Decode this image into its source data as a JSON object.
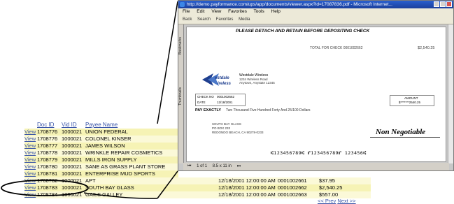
{
  "list": {
    "headers": {
      "doc_id": "Doc ID",
      "vid": "Vid ID",
      "payee": "Payee Name"
    },
    "view_label": "View",
    "rows": [
      {
        "doc": "1708776",
        "vid": "1000021",
        "payee": "UNION FEDERAL"
      },
      {
        "doc": "1708776",
        "vid": "1000021",
        "payee": "COLONEL KINSER"
      },
      {
        "doc": "1708777",
        "vid": "1000021",
        "payee": "JAMES WILSON"
      },
      {
        "doc": "1708778",
        "vid": "1000021",
        "payee": "WRINKLE REPAIR COSMETICS"
      },
      {
        "doc": "1708779",
        "vid": "1000021",
        "payee": "MILLS IRON SUPPLY"
      },
      {
        "doc": "1708780",
        "vid": "1000021",
        "payee": "SANE AS GRASS PLANT STORE"
      },
      {
        "doc": "1708781",
        "vid": "1000021",
        "payee": "ENTERPRISE MUD SPORTS"
      }
    ],
    "wide_rows": [
      {
        "doc": "1708782",
        "vid": "1000021",
        "payee": "APT",
        "date": "12/18/2001 12:00:00 AM",
        "num": "0001002661",
        "amount": "$37.95"
      },
      {
        "doc": "1708783",
        "vid": "1000021",
        "payee": "SOUTH BAY GLASS",
        "date": "12/18/2001 12:00:00 AM",
        "num": "0001002662",
        "amount": "$2,540.25"
      },
      {
        "doc": "1708784",
        "vid": "1000021",
        "payee": "GAILS GALLEY",
        "date": "12/18/2001 12:00:00 AM",
        "num": "0001002663",
        "amount": "$557.00"
      }
    ],
    "pager": {
      "prev": "<< Prev",
      "next": "Next >>"
    }
  },
  "viewer": {
    "title": "http://demo.payformance.com/ups/app/documents/viewer.aspx?id=17087836.pdf - Microsoft Internet...",
    "menu": [
      "File",
      "Edit",
      "View",
      "Favorites",
      "Tools",
      "Help"
    ],
    "toolbar": [
      "Back",
      "Search",
      "Favorites",
      "Media"
    ],
    "side_tabs": [
      "Bookmarks",
      "Thumbnails"
    ],
    "status": {
      "page": "1 of 1",
      "size": "8.5 x 11 in"
    },
    "check": {
      "detach_text": "PLEASE DETACH AND RETAIN BEFORE DEPOSITING CHECK",
      "total_label": "TOTAL FOR CHECK 0001002662",
      "total_amount": "$2,540.25",
      "company": "Westdale Wireless",
      "company_addr1": "1234 Wireless Road",
      "company_addr2": "Anytown, Anystate 12345",
      "check_no_label": "CHECK NO",
      "check_no": "0001002662",
      "date_label": "DATE",
      "date": "12/18/2001",
      "amount_label": "AMOUNT",
      "amount": "$*******2540.25",
      "pay_label": "PAY EXACTLY",
      "pay_text": "Two Thousand Five Hundred Forty And 25/100 Dollars",
      "payee_line1": "SOUTH BAY GLASS",
      "payee_line2": "PO BOX 233",
      "payee_line3": "REDONDO BEACH, CA 90278-0233",
      "non_negotiable": "Non Negotiable",
      "micr": "⑆123456789⑆ ⑈123456789⑈ 123456⑆"
    }
  },
  "colors": {
    "row_a": "#f6f3b5",
    "row_b": "#fbf9d8",
    "link": "#3a55a8",
    "title_bar": "#2a5fcf"
  }
}
